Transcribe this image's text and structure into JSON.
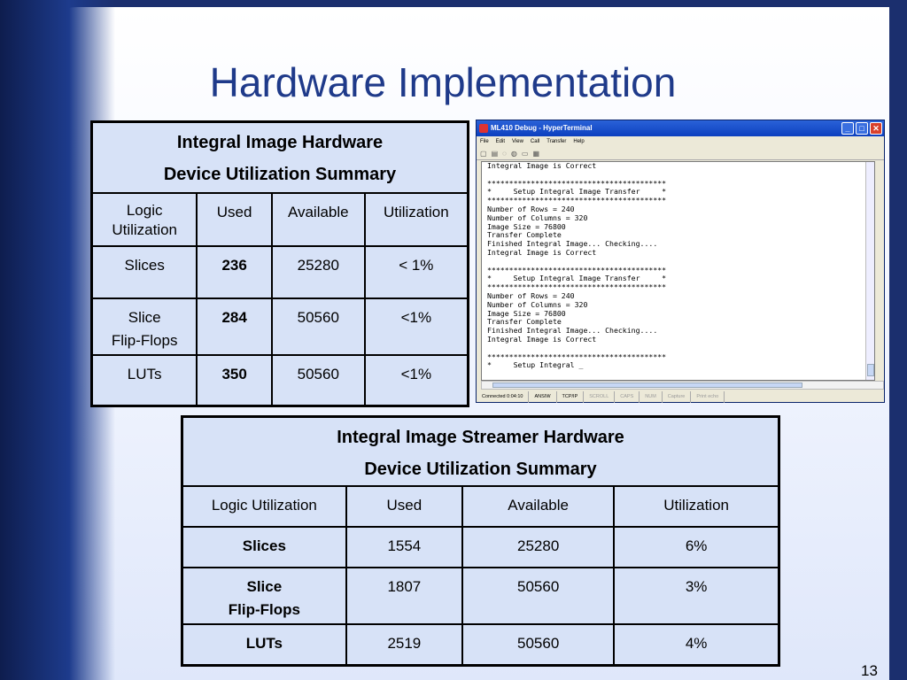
{
  "title": "Hardware Implementation",
  "slide_number": "13",
  "table1": {
    "title_line1": "Integral Image Hardware",
    "title_line2": "Device Utilization Summary",
    "headers": [
      "Logic Utilization",
      "Used",
      "Available",
      "Utilization"
    ],
    "rows": [
      {
        "label": "Slices",
        "used": "236",
        "available": "25280",
        "utilization": "< 1%"
      },
      {
        "label_line1": "Slice",
        "label_line2": "Flip-Flops",
        "used": "284",
        "available": "50560",
        "utilization": "<1%"
      },
      {
        "label": "LUTs",
        "used": "350",
        "available": "50560",
        "utilization": "<1%"
      }
    ]
  },
  "table2": {
    "title_line1": "Integral Image Streamer Hardware",
    "title_line2": "Device Utilization Summary",
    "headers": [
      "Logic Utilization",
      "Used",
      "Available",
      "Utilization"
    ],
    "rows": [
      {
        "label": "Slices",
        "used": "1554",
        "available": "25280",
        "utilization": "6%"
      },
      {
        "label_line1": "Slice",
        "label_line2": "Flip-Flops",
        "used": "1807",
        "available": "50560",
        "utilization": "3%"
      },
      {
        "label": "LUTs",
        "used": "2519",
        "available": "50560",
        "utilization": "4%"
      }
    ]
  },
  "terminal": {
    "window_title": "ML410 Debug - HyperTerminal",
    "menu": [
      "File",
      "Edit",
      "View",
      "Call",
      "Transfer",
      "Help"
    ],
    "text": "Integral Image is Correct\n\n*****************************************\n*     Setup Integral Image Transfer     *\n*****************************************\nNumber of Rows = 240\nNumber of Columns = 320\nImage Size = 76800\nTransfer Complete\nFinished Integral Image... Checking....\nIntegral Image is Correct\n\n*****************************************\n*     Setup Integral Image Transfer     *\n*****************************************\nNumber of Rows = 240\nNumber of Columns = 320\nImage Size = 76800\nTransfer Complete\nFinished Integral Image... Checking....\nIntegral Image is Correct\n\n*****************************************\n*     Setup Integral _",
    "status": {
      "connected": "Connected 0:04:10",
      "emulation": "ANSIW",
      "protocol": "TCP/IP",
      "scroll": "SCROLL",
      "caps": "CAPS",
      "num": "NUM",
      "capture": "Capture",
      "print_echo": "Print echo"
    }
  },
  "colors": {
    "title": "#1f3a8a",
    "table_bg": "#d7e2f7",
    "highlight": "#e00000",
    "background_dark": "#1b2f6e"
  }
}
